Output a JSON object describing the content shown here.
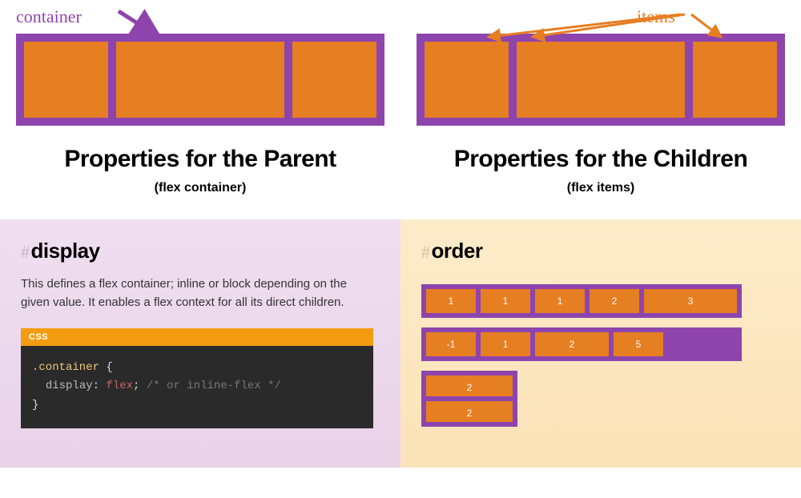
{
  "top": {
    "container_label": "container",
    "items_label": "items"
  },
  "headings": {
    "parent_title": "Properties for the Parent",
    "parent_sub": "(flex container)",
    "children_title": "Properties for the Children",
    "children_sub": "(flex items)"
  },
  "display_panel": {
    "hash": "#",
    "title": "display",
    "desc": "This defines a flex container; inline or block depending on the given value. It enables a flex context for all its direct children.",
    "code": {
      "lang": "CSS",
      "selector": ".container",
      "open": " {",
      "prop": "display",
      "colon": ": ",
      "value": "flex",
      "semi": ";",
      "comment": " /* or inline-flex */",
      "close": "}"
    }
  },
  "order_panel": {
    "hash": "#",
    "title": "order",
    "row1": [
      "1",
      "1",
      "1",
      "2",
      "3"
    ],
    "row1_widths": [
      62,
      62,
      62,
      62,
      146
    ],
    "row2": [
      "-1",
      "1",
      "2",
      "5"
    ],
    "row2_widths": [
      62,
      62,
      92,
      62
    ],
    "row3": [
      "2",
      "2"
    ]
  },
  "colors": {
    "purple": "#8e44ad",
    "orange": "#e67e22"
  }
}
